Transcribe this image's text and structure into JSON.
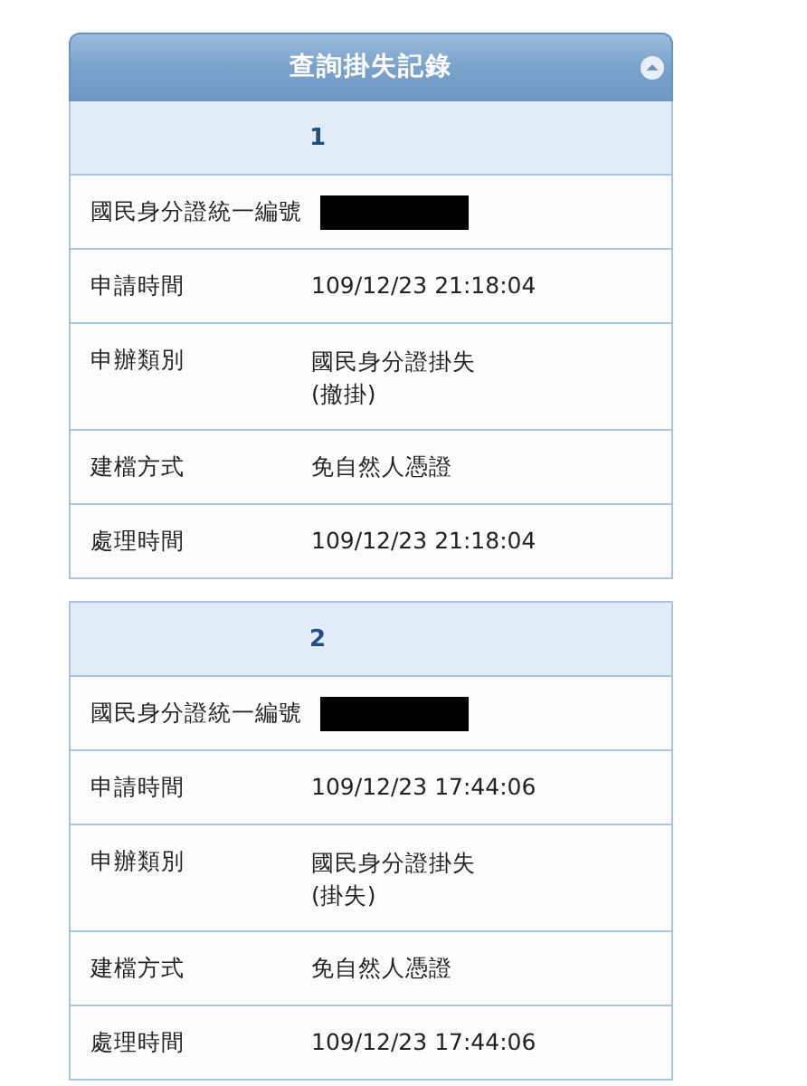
{
  "panel": {
    "title": "查詢掛失記錄"
  },
  "records": [
    {
      "index": "1",
      "rows": [
        {
          "label": "國民身分證統一編號",
          "kind": "redacted"
        },
        {
          "label": "申請時間",
          "kind": "text",
          "lines": [
            "109/12/23 21:18:04"
          ]
        },
        {
          "label": "申辦類別",
          "kind": "text",
          "lines": [
            "國民身分證掛失",
            "(撤掛)"
          ]
        },
        {
          "label": "建檔方式",
          "kind": "text",
          "lines": [
            "免自然人憑證"
          ]
        },
        {
          "label": "處理時間",
          "kind": "text",
          "lines": [
            "109/12/23 21:18:04"
          ]
        }
      ]
    },
    {
      "index": "2",
      "rows": [
        {
          "label": "國民身分證統一編號",
          "kind": "redacted"
        },
        {
          "label": "申請時間",
          "kind": "text",
          "lines": [
            "109/12/23 17:44:06"
          ]
        },
        {
          "label": "申辦類別",
          "kind": "text",
          "lines": [
            "國民身分證掛失",
            "(掛失)"
          ]
        },
        {
          "label": "建檔方式",
          "kind": "text",
          "lines": [
            "免自然人憑證"
          ]
        },
        {
          "label": "處理時間",
          "kind": "text",
          "lines": [
            "109/12/23 17:44:06"
          ]
        }
      ]
    }
  ]
}
